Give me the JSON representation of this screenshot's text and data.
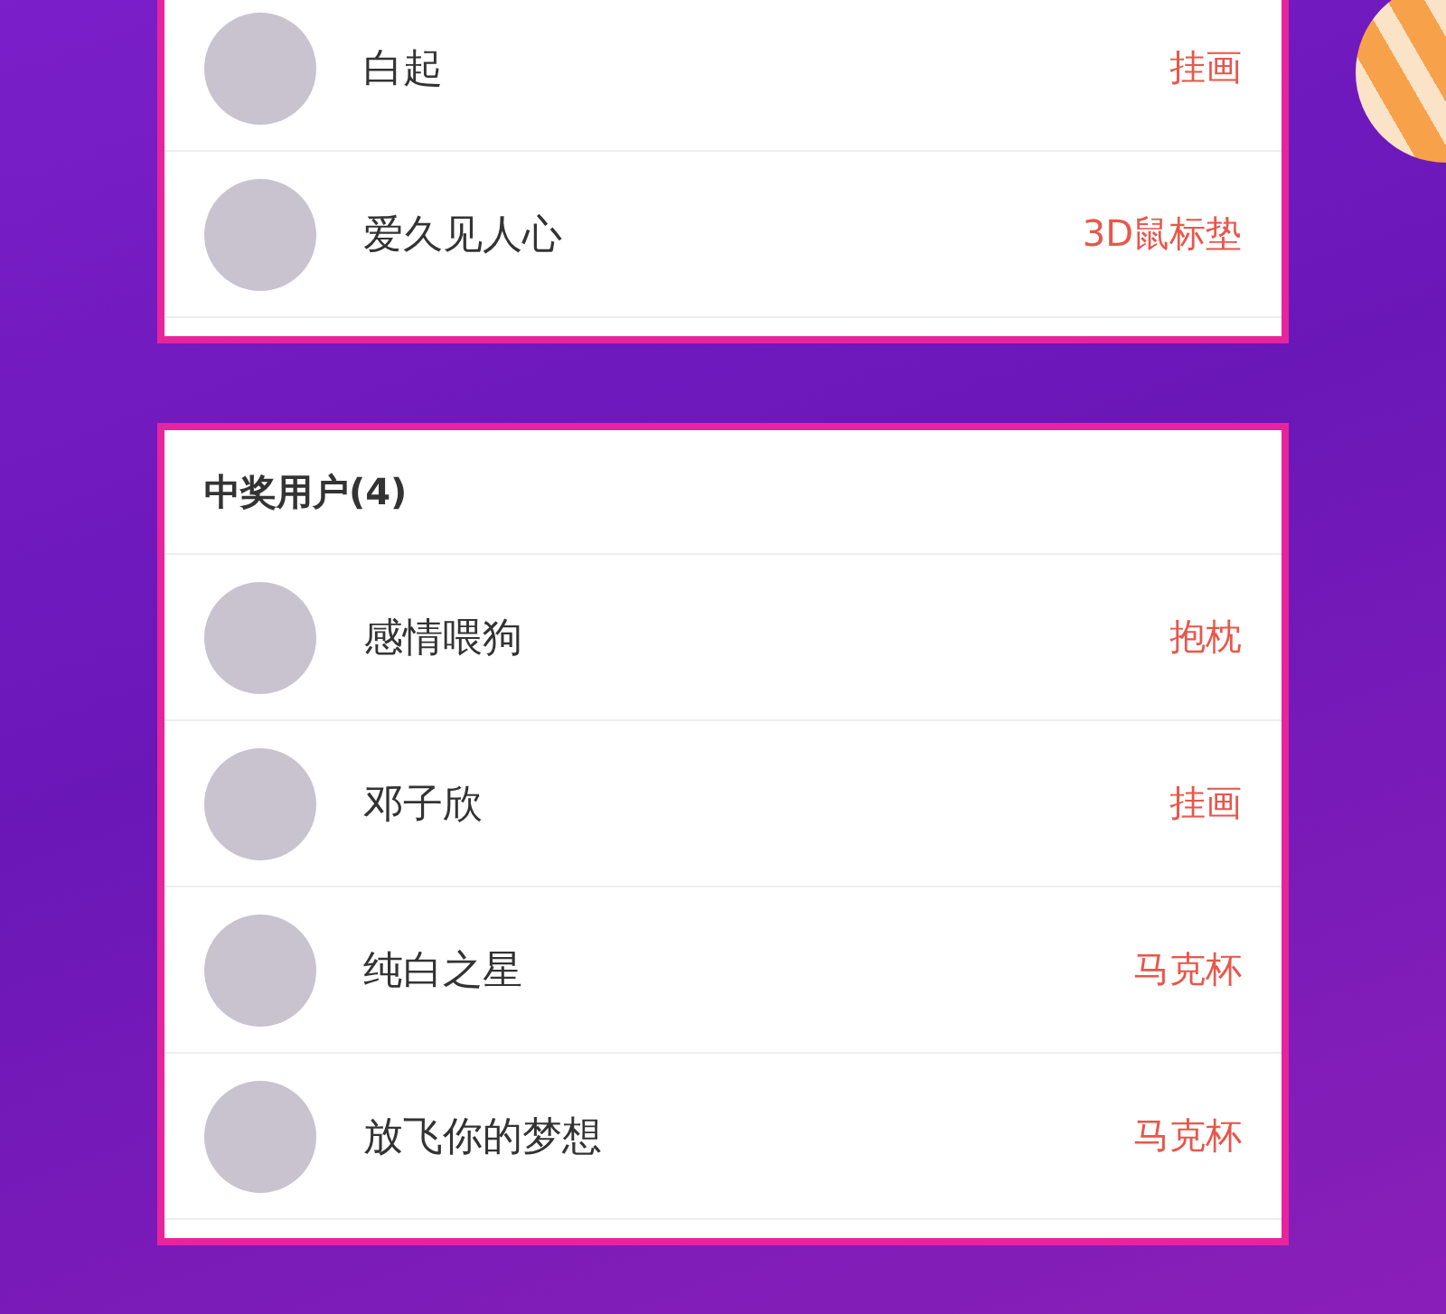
{
  "lists": [
    {
      "rows": [
        {
          "name": "白起",
          "prize": "挂画"
        },
        {
          "name": "爱久见人心",
          "prize": "3D鼠标垫"
        }
      ]
    },
    {
      "header": "中奖用户(4)",
      "rows": [
        {
          "name": "感情喂狗",
          "prize": "抱枕"
        },
        {
          "name": "邓子欣",
          "prize": "挂画"
        },
        {
          "name": "纯白之星",
          "prize": "马克杯"
        },
        {
          "name": "放飞你的梦想",
          "prize": "马克杯"
        }
      ]
    }
  ]
}
